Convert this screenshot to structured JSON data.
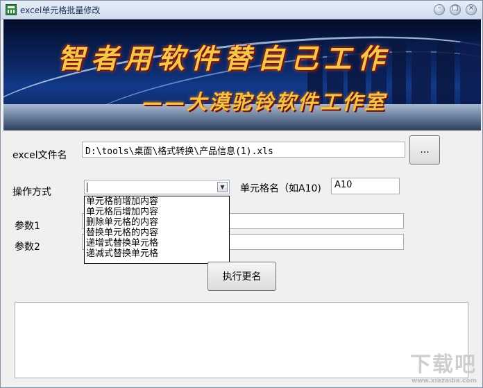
{
  "window": {
    "title": "excel单元格批量修改"
  },
  "banner": {
    "slogan": "智者用软件替自己工作",
    "studio": "——大漠驼铃软件工作室"
  },
  "form": {
    "file_label": "excel文件名",
    "file_value": "D:\\tools\\桌面\\格式转换\\产品信息(1).xls",
    "browse_label": "...",
    "mode_label": "操作方式",
    "mode_value": "",
    "mode_options": [
      "单元格前增加内容",
      "单元格后增加内容",
      "删除单元格的内容",
      "替换单元格的内容",
      "递增式替换单元格",
      "递减式替换单元格"
    ],
    "cell_label": "单元格名（如A10)",
    "cell_value": "A10",
    "param1_label": "参数1",
    "param1_value": "",
    "param2_label": "参数2",
    "param2_value": "",
    "execute_label": "执行更名",
    "output_text": ""
  },
  "watermark": {
    "text": "下载吧",
    "url": "www.xiazaiba.com"
  }
}
